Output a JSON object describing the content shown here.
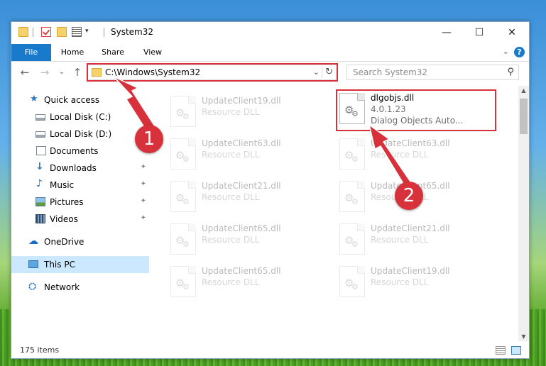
{
  "window": {
    "title": "System32",
    "controls": {
      "minimize": "—",
      "maximize": "☐",
      "close": "✕"
    }
  },
  "ribbon": {
    "tabs": [
      "File",
      "Home",
      "Share",
      "View"
    ],
    "collapse": "⌄",
    "help": "?"
  },
  "navigation": {
    "back": "←",
    "forward": "→",
    "recent": "⌄",
    "up": "↑",
    "address": "C:\\Windows\\System32",
    "address_dropdown": "⌄",
    "refresh": "↻",
    "search_placeholder": "Search System32",
    "search_icon": "magnifier-icon"
  },
  "sidebar": {
    "items": [
      {
        "label": "Quick access",
        "icon": "star-icon",
        "glyph": "★",
        "pinned": false
      },
      {
        "label": "Local Disk (C:)",
        "icon": "drive-icon",
        "pinned": true
      },
      {
        "label": "Local Disk (D:)",
        "icon": "drive-icon",
        "pinned": true
      },
      {
        "label": "Documents",
        "icon": "documents-icon",
        "pinned": true
      },
      {
        "label": "Downloads",
        "icon": "download-icon",
        "glyph": "↓",
        "pinned": true
      },
      {
        "label": "Music",
        "icon": "music-icon",
        "glyph": "♪",
        "pinned": true
      },
      {
        "label": "Pictures",
        "icon": "pictures-icon",
        "pinned": true
      },
      {
        "label": "Videos",
        "icon": "videos-icon",
        "pinned": true
      },
      {
        "label": "OneDrive",
        "icon": "cloud-icon",
        "glyph": "☁"
      },
      {
        "label": "This PC",
        "icon": "computer-icon",
        "selected": true
      },
      {
        "label": "Network",
        "icon": "network-icon",
        "glyph": "⛭"
      }
    ],
    "pin_glyph": "📌"
  },
  "files": {
    "left_column": [
      {
        "name": "UpdateClient19.dll",
        "type": "Resource DLL"
      },
      {
        "name": "UpdateClient63.dll",
        "type": "Resource DLL"
      },
      {
        "name": "UpdateClient21.dll",
        "type": "Resource DLL"
      },
      {
        "name": "UpdateClient65.dll",
        "type": "Resource DLL"
      },
      {
        "name": "UpdateClient65.dll",
        "type": "Resource DLL"
      }
    ],
    "right_column": [
      {
        "name": "dlgobjs.dll",
        "version": "4.0.1.23",
        "type": "Dialog Objects Auto...",
        "highlighted": true
      },
      {
        "name": "UpdateClient63.dll",
        "type": "Resource DLL"
      },
      {
        "name": "UpdateClient65.dll",
        "type": "Resource DLL"
      },
      {
        "name": "UpdateClient21.dll",
        "type": "Resource DLL"
      },
      {
        "name": "UpdateClient19.dll",
        "type": "Resource DLL"
      }
    ]
  },
  "status": {
    "item_count": "175 items"
  },
  "annotations": {
    "step1": "1",
    "step2": "2",
    "accent": "#d7323b"
  }
}
